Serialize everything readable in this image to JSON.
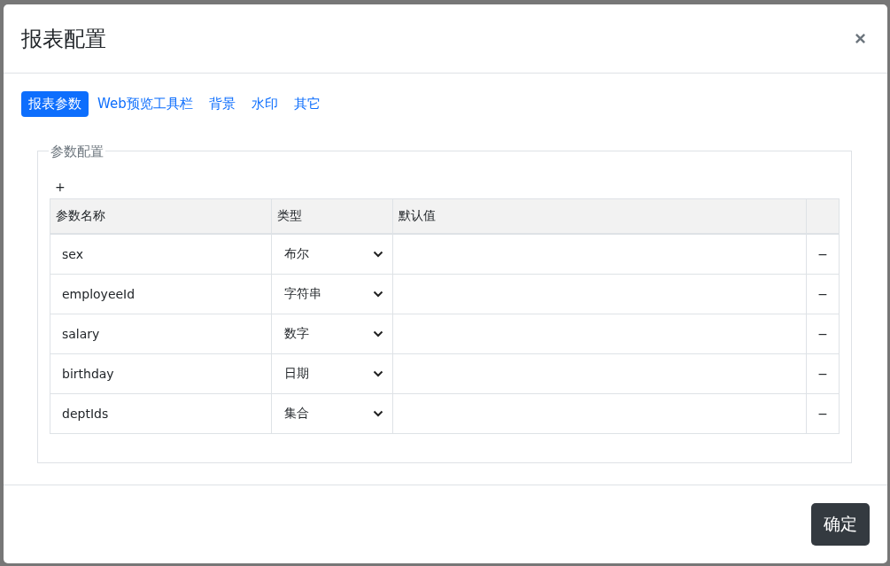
{
  "dialog": {
    "title": "报表配置"
  },
  "tabs": [
    {
      "label": "报表参数",
      "selected": true
    },
    {
      "label": "Web预览工具栏",
      "selected": false
    },
    {
      "label": "背景",
      "selected": false
    },
    {
      "label": "水印",
      "selected": false
    },
    {
      "label": "其它",
      "selected": false
    }
  ],
  "section": {
    "legend": "参数配置",
    "add_label": "+"
  },
  "table": {
    "columns": [
      "参数名称",
      "类型",
      "默认值"
    ],
    "rows": [
      {
        "name": "sex",
        "type": "布尔",
        "remove": "−"
      },
      {
        "name": "employeeId",
        "type": "字符串",
        "remove": "−"
      },
      {
        "name": "salary",
        "type": "数字",
        "remove": "−"
      },
      {
        "name": "birthday",
        "type": "日期",
        "remove": "−"
      },
      {
        "name": "deptIds",
        "type": "集合",
        "remove": "−"
      }
    ]
  },
  "buttons": [
    "确定"
  ]
}
